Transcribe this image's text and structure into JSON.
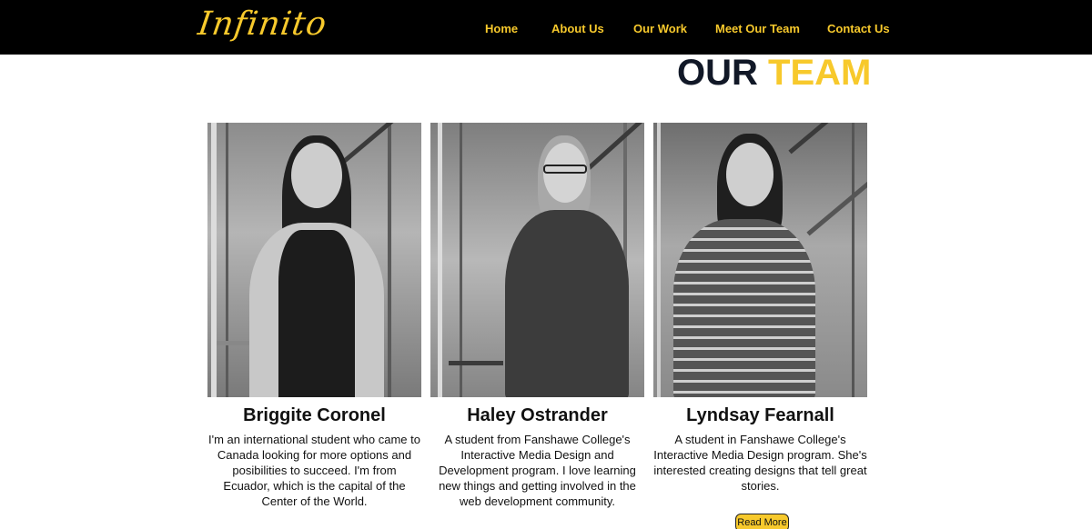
{
  "brand": {
    "logo_text": "Infinito",
    "accent_color": "#f7c92c",
    "heading_color": "#111827"
  },
  "nav": {
    "items": [
      {
        "label": "Home"
      },
      {
        "label": "About Us"
      },
      {
        "label": "Our Work"
      },
      {
        "label": "Meet Our Team"
      },
      {
        "label": "Contact Us"
      }
    ]
  },
  "heading": {
    "word1": "OUR",
    "word2": "TEAM"
  },
  "team": [
    {
      "name": "Briggite Coronel",
      "bio": "I'm an international student who came to Canada looking for more options and posibilities to succeed. I'm from Ecuador, which is the capital of the Center of the World."
    },
    {
      "name": "Haley Ostrander",
      "bio": "A student from Fanshawe College's Interactive Media Design and Development program. I love learning new things and getting involved in the web development community."
    },
    {
      "name": "Lyndsay Fearnall",
      "bio": "A student in Fanshawe College's Interactive Media Design program. She's interested creating designs that tell great stories."
    }
  ],
  "read_more_label": "Read More"
}
